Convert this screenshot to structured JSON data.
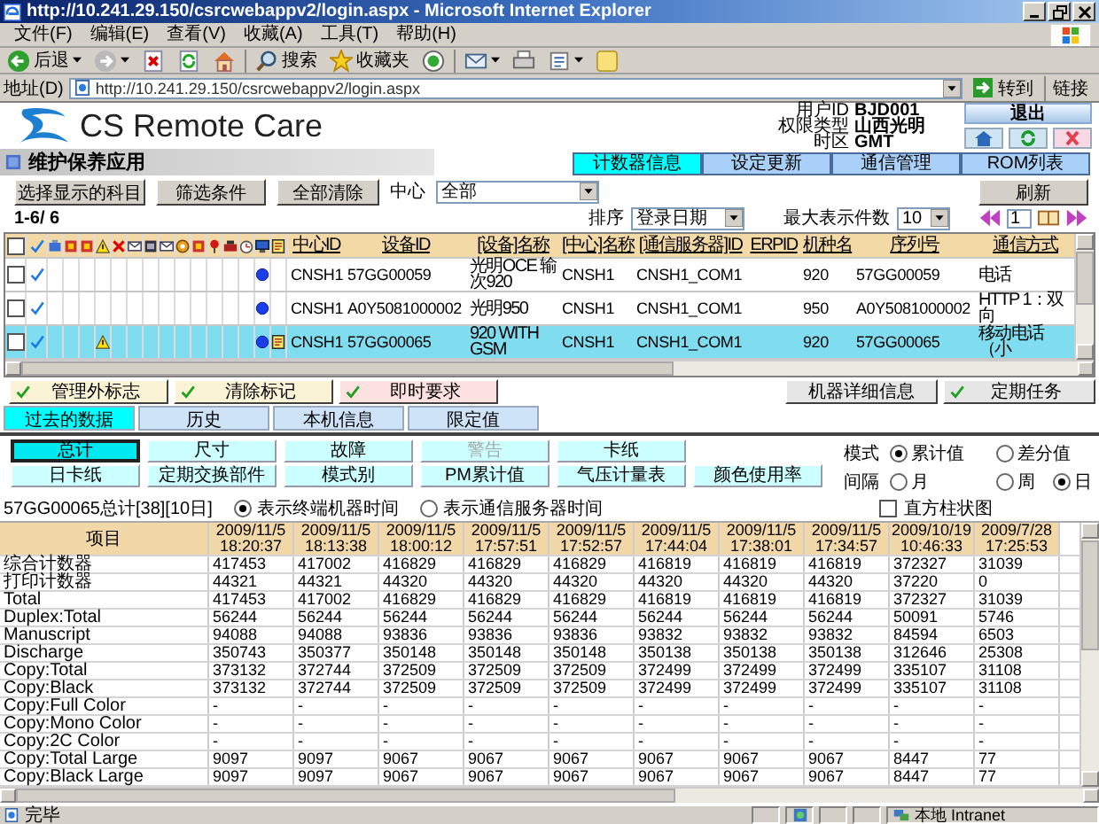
{
  "window": {
    "title": "http://10.241.29.150/csrcwebappv2/login.aspx - Microsoft Internet Explorer",
    "menu": [
      "文件(F)",
      "编辑(E)",
      "查看(V)",
      "收藏(A)",
      "工具(T)",
      "帮助(H)"
    ],
    "toolbar": {
      "back": "后退",
      "search": "搜索",
      "favorites": "收藏夹"
    },
    "address": {
      "label": "地址(D)",
      "url": "http://10.241.29.150/csrcwebappv2/login.aspx",
      "go": "转到",
      "links": "链接"
    }
  },
  "header": {
    "logo": "CS Remote Care",
    "info": [
      {
        "label": "用户ID",
        "value": "BJD001"
      },
      {
        "label": "权限类型",
        "value": "山西光明"
      },
      {
        "label": "时区",
        "value": "GMT"
      }
    ],
    "logout": "退出"
  },
  "section_title": "维护保养应用",
  "tabs": [
    {
      "label": "计数器信息",
      "selected": true
    },
    {
      "label": "设定更新",
      "selected": false
    },
    {
      "label": "通信管理",
      "selected": false
    },
    {
      "label": "ROM列表",
      "selected": false
    }
  ],
  "filter": {
    "buttons": [
      "选择显示的科目",
      "筛选条件",
      "全部清除"
    ],
    "center_label": "中心",
    "center_value": "全部",
    "refresh": "刷新",
    "count": "1-6/ 6",
    "sort_label": "排序",
    "sort_value": "登录日期",
    "max_label": "最大表示件数",
    "max_value": "10",
    "page": "1"
  },
  "device_table": {
    "select_all_checked": false,
    "columns": [
      "中心ID",
      "设备ID",
      "[设备]名称",
      "[中心]名称",
      "[通信服务器]ID",
      "ERPID",
      "机种名",
      "序列号",
      "通信方式"
    ],
    "rows": [
      {
        "checked": false,
        "verified": true,
        "warning": false,
        "connected": true,
        "memo": false,
        "selected": false,
        "center_id": "CNSH1",
        "device_id": "57GG00059",
        "device_name": "光明OCE 输次920",
        "center_name": "CNSH1",
        "server_id": "CNSH1_COM1",
        "model": "920",
        "serial": "57GG00059",
        "comm": "电话"
      },
      {
        "checked": false,
        "verified": true,
        "warning": false,
        "connected": true,
        "memo": false,
        "selected": false,
        "center_id": "CNSH1",
        "device_id": "A0Y5081000002",
        "device_name": "光明950",
        "center_name": "CNSH1",
        "server_id": "CNSH1_COM1",
        "model": "950",
        "serial": "A0Y5081000002",
        "comm": "HTTP 1：双向"
      },
      {
        "checked": false,
        "verified": true,
        "warning": true,
        "connected": true,
        "memo": true,
        "selected": true,
        "center_id": "CNSH1",
        "device_id": "57GG00065",
        "device_name": "920 WITH GSM",
        "center_name": "CNSH1",
        "server_id": "CNSH1_COM1",
        "model": "920",
        "serial": "57GG00065",
        "comm": "移动电话（小"
      }
    ]
  },
  "actions": {
    "left": [
      {
        "label": "管理外标志",
        "checked": true,
        "kind": "flag"
      },
      {
        "label": "清除标记",
        "checked": true,
        "kind": "flag"
      },
      {
        "label": "即时要求",
        "checked": true,
        "kind": "request"
      }
    ],
    "right": [
      {
        "label": "机器详细信息",
        "checked": false,
        "kind": "plain"
      },
      {
        "label": "定期任务",
        "checked": true,
        "kind": "plain"
      }
    ]
  },
  "data_tabs": [
    {
      "label": "过去的数据",
      "selected": true
    },
    {
      "label": "历史",
      "selected": false
    },
    {
      "label": "本机信息",
      "selected": false
    },
    {
      "label": "限定值",
      "selected": false
    }
  ],
  "counter_types": {
    "rows": [
      {
        "items": [
          {
            "label": "总计",
            "selected": true,
            "disabled": false
          },
          {
            "label": "尺寸",
            "selected": false,
            "disabled": false
          },
          {
            "label": "故障",
            "selected": false,
            "disabled": false
          },
          {
            "label": "警告",
            "selected": false,
            "disabled": true
          },
          {
            "label": "卡纸",
            "selected": false,
            "disabled": false
          }
        ]
      },
      {
        "items": [
          {
            "label": "日卡纸",
            "selected": false,
            "disabled": false
          },
          {
            "label": "定期交换部件",
            "selected": false,
            "disabled": false
          },
          {
            "label": "模式别",
            "selected": false,
            "disabled": false
          },
          {
            "label": "PM累计值",
            "selected": false,
            "disabled": false
          },
          {
            "label": "气压计量表",
            "selected": false,
            "disabled": false
          },
          {
            "label": "颜色使用率",
            "selected": false,
            "disabled": false
          }
        ]
      }
    ]
  },
  "mode": {
    "label": "模式",
    "options": [
      {
        "label": "累计值",
        "selected": true
      },
      {
        "label": "差分值",
        "selected": false
      }
    ]
  },
  "interval": {
    "label": "间隔",
    "options": [
      {
        "label": "月",
        "selected": false
      },
      {
        "label": "周",
        "selected": false
      },
      {
        "label": "日",
        "selected": true
      }
    ]
  },
  "summary": {
    "title": "57GG00065总计[38][10日]",
    "time_options": [
      {
        "label": "表示终端机器时间",
        "selected": true
      },
      {
        "label": "表示通信服务器时间",
        "selected": false
      }
    ],
    "histogram": {
      "label": "直方柱状图",
      "checked": false
    }
  },
  "counter_table": {
    "item_header": "项目",
    "columns": [
      {
        "date": "2009/11/5",
        "time": "18:20:37"
      },
      {
        "date": "2009/11/5",
        "time": "18:13:38"
      },
      {
        "date": "2009/11/5",
        "time": "18:00:12"
      },
      {
        "date": "2009/11/5",
        "time": "17:57:51"
      },
      {
        "date": "2009/11/5",
        "time": "17:52:57"
      },
      {
        "date": "2009/11/5",
        "time": "17:44:04"
      },
      {
        "date": "2009/11/5",
        "time": "17:38:01"
      },
      {
        "date": "2009/11/5",
        "time": "17:34:57"
      },
      {
        "date": "2009/10/19",
        "time": "10:46:33"
      },
      {
        "date": "2009/7/28",
        "time": "17:25:53"
      }
    ],
    "rows": [
      {
        "item": "综合计数器",
        "values": [
          "417453",
          "417002",
          "416829",
          "416829",
          "416829",
          "416819",
          "416819",
          "416819",
          "372327",
          "31039"
        ]
      },
      {
        "item": "打印计数器",
        "values": [
          "44321",
          "44321",
          "44320",
          "44320",
          "44320",
          "44320",
          "44320",
          "44320",
          "37220",
          "0"
        ]
      },
      {
        "item": "Total",
        "values": [
          "417453",
          "417002",
          "416829",
          "416829",
          "416829",
          "416819",
          "416819",
          "416819",
          "372327",
          "31039"
        ]
      },
      {
        "item": "Duplex:Total",
        "values": [
          "56244",
          "56244",
          "56244",
          "56244",
          "56244",
          "56244",
          "56244",
          "56244",
          "50091",
          "5746"
        ]
      },
      {
        "item": "Manuscript",
        "values": [
          "94088",
          "94088",
          "93836",
          "93836",
          "93836",
          "93832",
          "93832",
          "93832",
          "84594",
          "6503"
        ]
      },
      {
        "item": "Discharge",
        "values": [
          "350743",
          "350377",
          "350148",
          "350148",
          "350148",
          "350138",
          "350138",
          "350138",
          "312646",
          "25308"
        ]
      },
      {
        "item": "Copy:Total",
        "values": [
          "373132",
          "372744",
          "372509",
          "372509",
          "372509",
          "372499",
          "372499",
          "372499",
          "335107",
          "31108"
        ]
      },
      {
        "item": "Copy:Black",
        "values": [
          "373132",
          "372744",
          "372509",
          "372509",
          "372509",
          "372499",
          "372499",
          "372499",
          "335107",
          "31108"
        ]
      },
      {
        "item": "Copy:Full Color",
        "values": [
          "-",
          "-",
          "-",
          "-",
          "-",
          "-",
          "-",
          "-",
          "-",
          "-"
        ]
      },
      {
        "item": "Copy:Mono Color",
        "values": [
          "-",
          "-",
          "-",
          "-",
          "-",
          "-",
          "-",
          "-",
          "-",
          "-"
        ]
      },
      {
        "item": "Copy:2C Color",
        "values": [
          "-",
          "-",
          "-",
          "-",
          "-",
          "-",
          "-",
          "-",
          "-",
          "-"
        ]
      },
      {
        "item": "Copy:Total Large",
        "values": [
          "9097",
          "9097",
          "9067",
          "9067",
          "9067",
          "9067",
          "9067",
          "9067",
          "8447",
          "77"
        ]
      },
      {
        "item": "Copy:Black Large",
        "values": [
          "9097",
          "9097",
          "9067",
          "9067",
          "9067",
          "9067",
          "9067",
          "9067",
          "8447",
          "77"
        ]
      }
    ]
  },
  "status_bar": {
    "text": "完毕",
    "zone": "本地 Intranet"
  }
}
